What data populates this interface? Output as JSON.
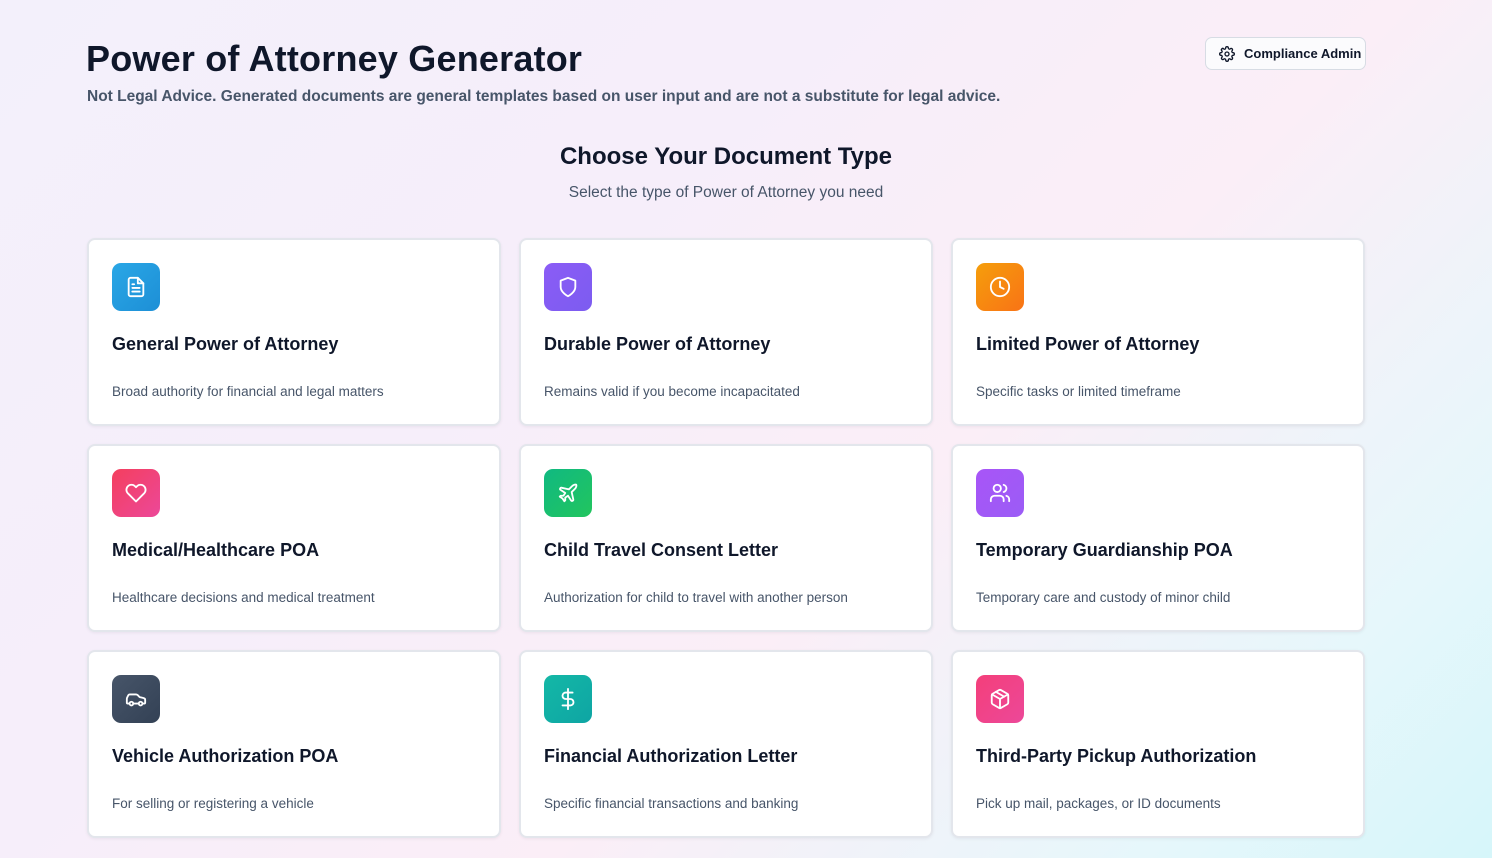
{
  "header": {
    "title": "Power of Attorney Generator",
    "disclaimer": "Not Legal Advice. Generated documents are general templates based on user input and are not a substitute for legal advice.",
    "admin_button": {
      "label": "Compliance Admin",
      "icon": "gear-icon"
    }
  },
  "section": {
    "title": "Choose Your Document Type",
    "subtitle": "Select the type of Power of Attorney you need"
  },
  "cards": [
    {
      "title": "General Power of Attorney",
      "description": "Broad authority for financial and legal matters",
      "icon": "document-icon",
      "color": "#1e9bdc"
    },
    {
      "title": "Durable Power of Attorney",
      "description": "Remains valid if you become incapacitated",
      "icon": "shield-icon",
      "color": "#8b5cf6"
    },
    {
      "title": "Limited Power of Attorney",
      "description": "Specific tasks or limited timeframe",
      "icon": "clock-icon",
      "color": "#f59e0b"
    },
    {
      "title": "Medical/Healthcare POA",
      "description": "Healthcare decisions and medical treatment",
      "icon": "heart-icon",
      "color": "#ef4465"
    },
    {
      "title": "Child Travel Consent Letter",
      "description": "Authorization for child to travel with another person",
      "icon": "plane-icon",
      "color": "#10b973"
    },
    {
      "title": "Temporary Guardianship POA",
      "description": "Temporary care and custody of minor child",
      "icon": "users-icon",
      "color": "#a855f7"
    },
    {
      "title": "Vehicle Authorization POA",
      "description": "For selling or registering a vehicle",
      "icon": "car-icon",
      "color": "#3b4556"
    },
    {
      "title": "Financial Authorization Letter",
      "description": "Specific financial transactions and banking",
      "icon": "dollar-icon",
      "color": "#14b8a6"
    },
    {
      "title": "Third-Party Pickup Authorization",
      "description": "Pick up mail, packages, or ID documents",
      "icon": "package-icon",
      "color": "#ec4886"
    }
  ]
}
